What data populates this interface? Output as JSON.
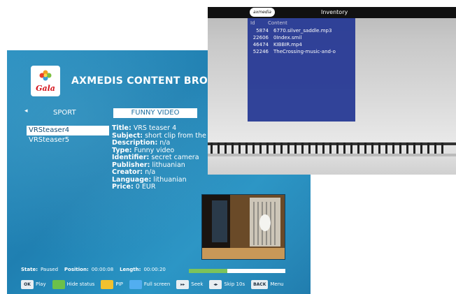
{
  "browser": {
    "title": "AXMEDIS CONTENT BROWSER",
    "logo_text": "Gala",
    "category_left_arrow": "◂",
    "categories": [
      "SPORT",
      "FUNNY VIDEO"
    ],
    "items": [
      "VRSteaser4",
      "VRSteaser5"
    ],
    "details": [
      {
        "key": "Title:",
        "value": "VRS teaser 4"
      },
      {
        "key": "Subject:",
        "value": "short clip from the"
      },
      {
        "key": "Description:",
        "value": "n/a"
      },
      {
        "key": "Type:",
        "value": "Funny video"
      },
      {
        "key": "Identifier:",
        "value": "secret camera"
      },
      {
        "key": "Publisher:",
        "value": "lithuanian"
      },
      {
        "key": "Creator:",
        "value": "n/a"
      },
      {
        "key": "Language:",
        "value": "lithuanian"
      },
      {
        "key": "Price:",
        "value": "0 EUR"
      }
    ],
    "status": {
      "state_label": "State:",
      "state_value": "Paused",
      "position_label": "Position:",
      "position_value": "00:00:08",
      "length_label": "Length:",
      "length_value": "00:00:20",
      "progress_fraction": 0.4
    },
    "controls": {
      "ok_key": "OK",
      "play": "Play",
      "hide_status": "Hide status",
      "pip": "PIP",
      "full_screen": "Full screen",
      "seek_key": "▸▸",
      "seek": "Seek",
      "skip_key": "◂▸",
      "skip": "Skip 10s",
      "back_key": "BACK",
      "menu": "Menu"
    },
    "colors": {
      "green": "#6cc04a",
      "yellow": "#f2c12e",
      "blue": "#52aef0"
    }
  },
  "inventory": {
    "logo_text": "axmedia",
    "title": "Inventory",
    "columns": [
      "Id",
      "Content"
    ],
    "rows": [
      {
        "id": "5874",
        "content": "6770.silver_saddle.mp3"
      },
      {
        "id": "22606",
        "content": "0Index.smil"
      },
      {
        "id": "46474",
        "content": "KIBBIR.mp4"
      },
      {
        "id": "52246",
        "content": "TheCrossing-music-and-o"
      }
    ]
  }
}
